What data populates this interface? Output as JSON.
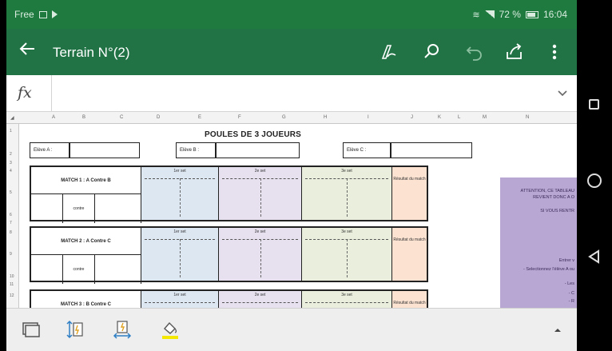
{
  "status_bar": {
    "carrier": "Free",
    "battery": "72 %",
    "time": "16:04"
  },
  "app_bar": {
    "title": "Terrain N°(2)",
    "icons": [
      "back-arrow-icon",
      "draw-pen-icon",
      "search-icon",
      "undo-icon",
      "share-icon",
      "more-vertical-icon"
    ]
  },
  "formula_bar": {
    "fx_label": "fx",
    "value": ""
  },
  "sheet": {
    "columns": [
      "A",
      "B",
      "C",
      "D",
      "E",
      "F",
      "G",
      "H",
      "I",
      "J",
      "K",
      "L",
      "M",
      "N"
    ],
    "rows": [
      "1",
      "2",
      "3",
      "4",
      "5",
      "6",
      "7",
      "8",
      "9",
      "10",
      "11",
      "12"
    ],
    "title": "POULES DE 3 JOUEURS",
    "eleves": [
      "Elève A :",
      "Elève B :",
      "Elève C :"
    ],
    "set_headers": [
      "1er set",
      "2e set",
      "3e set"
    ],
    "result_label": "Résultat du match",
    "contre": "contre",
    "matches": [
      {
        "name": "MATCH 1 : A Contre B"
      },
      {
        "name": "MATCH 2 : A Contre C"
      },
      {
        "name": "MATCH 3 : B Contre C"
      }
    ],
    "note_lines": [
      "ATTENTION, CE TABLEAU",
      "REVIENT DONC A O",
      "SI VOUS RENTR",
      "Entrer v",
      "- Selectionnez l'élève A ou",
      "- Les",
      "- C",
      "- R"
    ]
  },
  "toolbar": {
    "icons": [
      "select-sheet-icon",
      "row-height-icon",
      "column-width-icon",
      "fill-color-icon",
      "expand-up-icon"
    ]
  },
  "nav": {
    "icons": [
      "recents-square-icon",
      "home-circle-icon",
      "back-triangle-icon"
    ]
  }
}
